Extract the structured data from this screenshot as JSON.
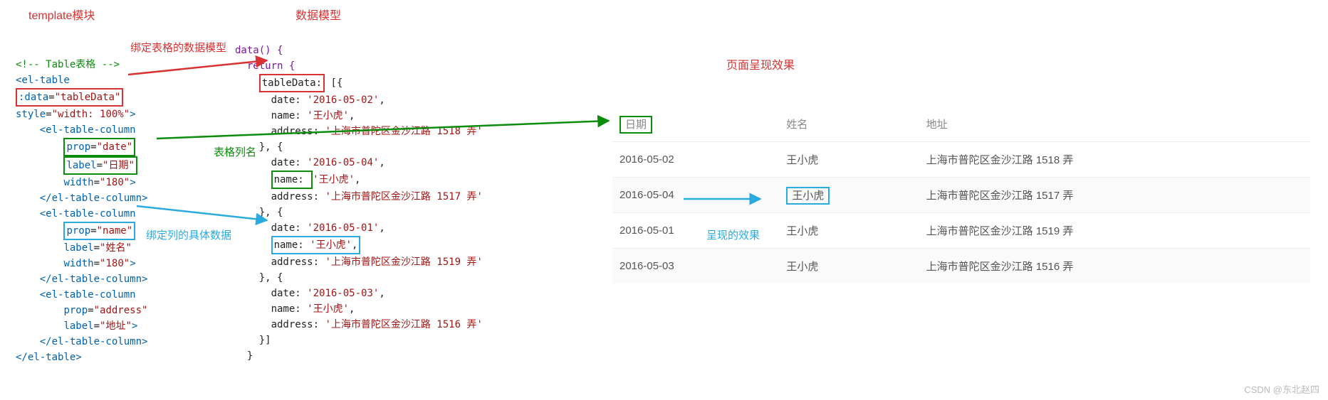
{
  "headings": {
    "template": "template模块",
    "datamodel": "数据模型",
    "render": "页面呈现效果"
  },
  "annotations": {
    "bind_model": "绑定表格的数据模型",
    "col_name": "表格列名",
    "bind_col_data": "绑定列的具体数据",
    "rendered_effect": "呈现的效果"
  },
  "code_left": {
    "comment": "<!-- Table表格 -->",
    "el_table_open": "<el-table",
    "data_attr_name": ":data",
    "data_attr_eq": "=",
    "data_attr_val": "\"tableData\"",
    "style_attr_name": "style",
    "style_attr_val": "\"width: 100%\"",
    "close_gt": ">",
    "col_open": "<el-table-column",
    "prop": "prop",
    "label": "label",
    "width_attr": "width",
    "date_prop_val": "\"date\"",
    "date_label_val": "\"日期\"",
    "width180": "\"180\"",
    "col_close": "</el-table-column>",
    "name_prop_val": "\"name\"",
    "name_label_val": "\"姓名\"",
    "addr_prop_val": "\"address\"",
    "addr_label_val": "\"地址\"",
    "el_table_close": "</el-table>"
  },
  "code_right": {
    "data_fn": "data() {",
    "return": "return {",
    "tableData_key": "tableData:",
    "arr_open": " [{",
    "date_key": "date: ",
    "name_key": "name: ",
    "address_key": "address: ",
    "row1_date": "'2016-05-02'",
    "row1_name": "'王小虎'",
    "row1_addr": "'上海市普陀区金沙江路 1518 弄'",
    "row2_date": "'2016-05-04'",
    "row2_name": "'王小虎'",
    "row2_addr": "'上海市普陀区金沙江路 1517 弄'",
    "row3_date": "'2016-05-01'",
    "row3_name": "'王小虎'",
    "row3_addr": "'上海市普陀区金沙江路 1519 弄'",
    "row4_date": "'2016-05-03'",
    "row4_name": "'王小虎'",
    "row4_addr": "'上海市普陀区金沙江路 1516 弄'",
    "sep": "}, {",
    "arr_close": "}]",
    "brace_close": "}",
    "comma": ","
  },
  "table": {
    "headers": {
      "date": "日期",
      "name": "姓名",
      "address": "地址"
    },
    "rows": [
      {
        "date": "2016-05-02",
        "name": "王小虎",
        "address": "上海市普陀区金沙江路 1518 弄"
      },
      {
        "date": "2016-05-04",
        "name": "王小虎",
        "address": "上海市普陀区金沙江路 1517 弄"
      },
      {
        "date": "2016-05-01",
        "name": "王小虎",
        "address": "上海市普陀区金沙江路 1519 弄"
      },
      {
        "date": "2016-05-03",
        "name": "王小虎",
        "address": "上海市普陀区金沙江路 1516 弄"
      }
    ]
  },
  "watermark": "CSDN @东北赵四"
}
